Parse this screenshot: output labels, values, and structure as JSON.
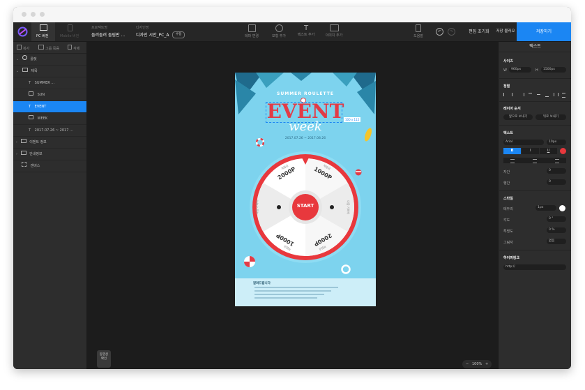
{
  "toolbar": {
    "pc_label": "PC 버전",
    "mobile_label": "Mobile 버전",
    "project_caption": "프로젝트명",
    "project_name": "돌려돌려 돌림판 ...",
    "design_caption": "디자인명",
    "design_name": "디자인 시안_PC_A",
    "edit_badge": "수정",
    "tools": [
      "테마 변경",
      "모형 추가",
      "텍스트 추가",
      "이미지 추가"
    ],
    "guide_label": "도움말",
    "reset_label": "편집 초기화",
    "load_label": "저장 불러오기",
    "save_label": "저장하기"
  },
  "layers": {
    "actions": [
      "복사",
      "그룹 묶음",
      "삭제"
    ],
    "items": [
      {
        "label": "룰렛",
        "kind": "group-root"
      },
      {
        "label": "제목",
        "kind": "folder"
      },
      {
        "label": "SUMMER ...",
        "kind": "text"
      },
      {
        "label": "SUN",
        "kind": "image"
      },
      {
        "label": "EVENT",
        "kind": "text",
        "selected": true
      },
      {
        "label": "WEEK",
        "kind": "image"
      },
      {
        "label": "2017.07.26 ~ 2017 ...",
        "kind": "text"
      },
      {
        "label": "이벤트 정보",
        "kind": "folder"
      },
      {
        "label": "안내정보",
        "kind": "folder"
      },
      {
        "label": "캔버스",
        "kind": "canvas"
      }
    ]
  },
  "poster": {
    "subtitle": "SUMMER ROULETTE",
    "title": "EVENT",
    "script": "week",
    "size_badge": "100 x 115",
    "date_range": "2017.07.26 ~ 2017.08.26",
    "start_label": "START",
    "prizes": [
      "2000P",
      "1000P",
      "2000P",
      "1000P"
    ],
    "prize_captions": [
      "적립금",
      "적립금",
      "적립금",
      "적립금"
    ],
    "side_captions": [
      "다음 기회에",
      "다음 기회에"
    ],
    "notice_title": "알려드립니다"
  },
  "bottom": {
    "preview_label_1": "동영상",
    "preview_label_2": "확인",
    "zoom": "100%",
    "zoom_minus": "−",
    "zoom_plus": "+"
  },
  "props": {
    "panel_title": "텍스트",
    "size_heading": "사이즈",
    "w_label": "W",
    "w_value": "960px",
    "h_label": "H",
    "h_value": "1500px",
    "align_heading": "정렬",
    "order_heading": "레이어 순서",
    "front_label": "앞으로 보내기",
    "back_label": "뒤로 보내기",
    "text_heading": "텍스트",
    "font_value": "Arial",
    "font_size_value": "10px",
    "bold_label": "B",
    "italic_label": "I",
    "underline_label": "U",
    "text_color": "#e8383d",
    "spacing_label": "자간",
    "spacing_value": "0",
    "line_label": "행간",
    "line_value": "0",
    "style_heading": "스타일",
    "border_label": "테두리",
    "border_value": "1px",
    "angle_label": "각도",
    "angle_value": "0 °",
    "opacity_label": "투명도",
    "opacity_value": "0 %",
    "shadow_label": "그림자",
    "shadow_value": "없음",
    "link_heading": "하이퍼링크",
    "link_value": "http://"
  },
  "colors": {
    "accent": "#1b86f3",
    "poster_bg": "#7dd3ee",
    "wheel_red": "#e8383d",
    "event_red": "#e23b46"
  }
}
